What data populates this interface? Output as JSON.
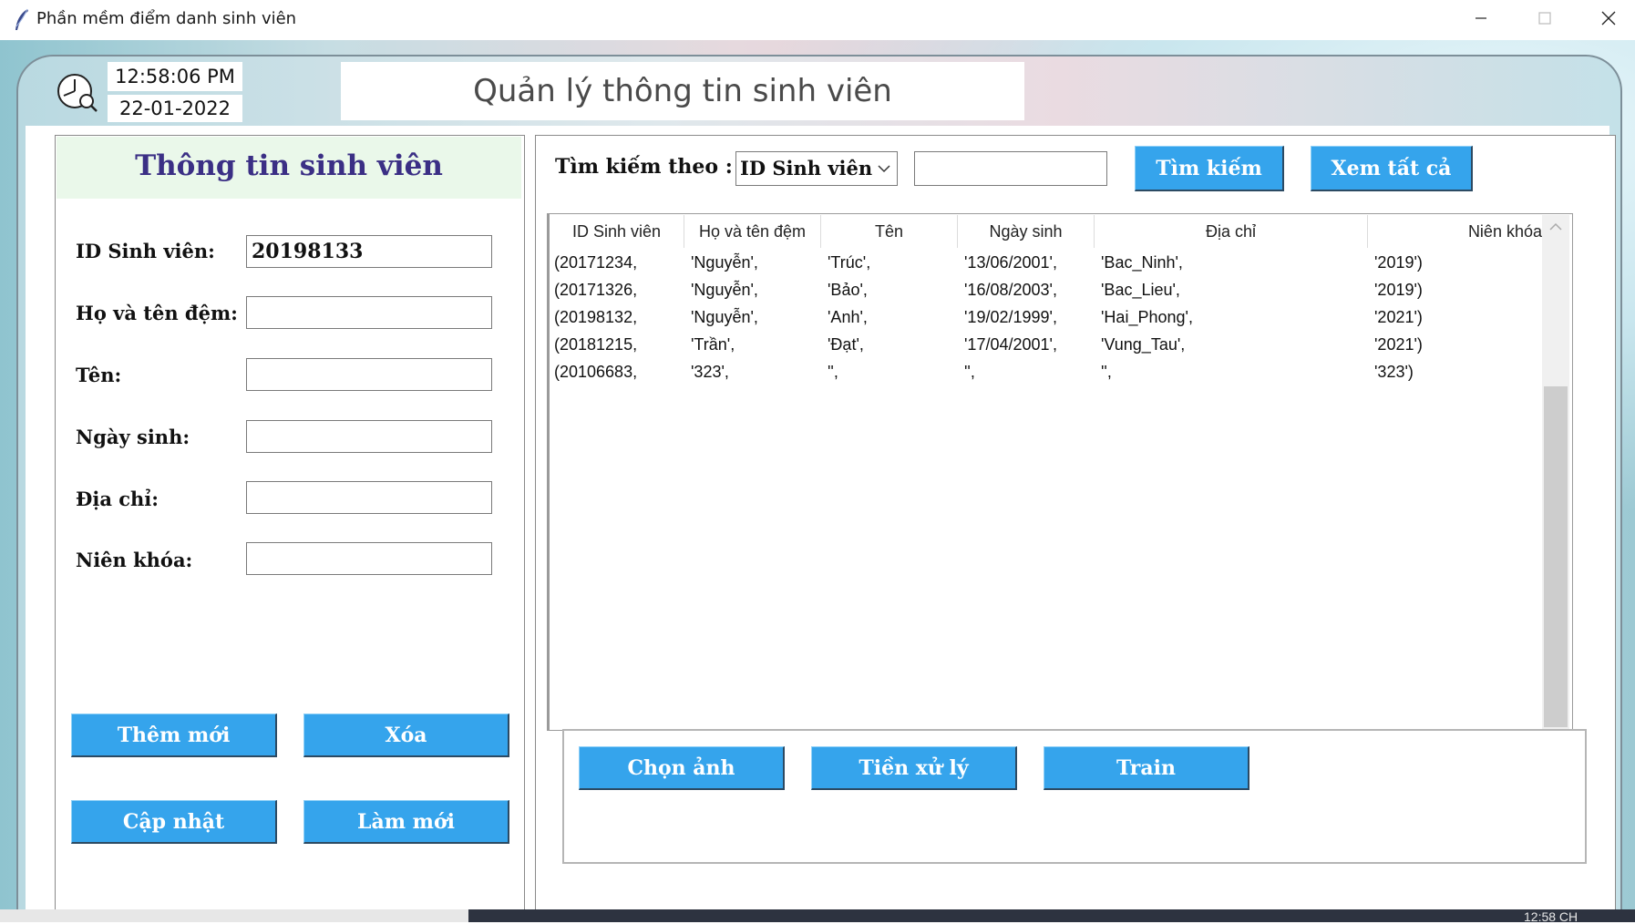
{
  "window": {
    "title": "Phần mềm điểm danh sinh viên",
    "minimize_icon": "minimize-icon",
    "maximize_icon": "maximize-icon",
    "close_icon": "close-icon"
  },
  "header": {
    "time": "12:58:06 PM",
    "date": "22-01-2022",
    "title": "Quản lý thông tin sinh viên",
    "clock_icon": "clock-icon"
  },
  "student_form": {
    "title": "Thông tin sinh viên",
    "fields": [
      {
        "label": "ID Sinh viên:",
        "value": "20198133"
      },
      {
        "label": "Họ và tên đệm:",
        "value": ""
      },
      {
        "label": "Tên:",
        "value": ""
      },
      {
        "label": "Ngày sinh:",
        "value": ""
      },
      {
        "label": "Địa chỉ:",
        "value": ""
      },
      {
        "label": "Niên khóa:",
        "value": ""
      }
    ],
    "buttons": {
      "add": "Thêm mới",
      "delete": "Xóa",
      "update": "Cập nhật",
      "refresh": "Làm mới"
    }
  },
  "search": {
    "label": "Tìm kiếm theo :",
    "selected": "ID Sinh viên",
    "query": "",
    "search_button": "Tìm kiếm",
    "view_all_button": "Xem tất cả"
  },
  "table": {
    "columns": [
      "ID Sinh viên",
      "Họ và tên đệm",
      "Tên",
      "Ngày sinh",
      "Địa chỉ",
      "Niên khóa"
    ],
    "rows": [
      [
        "(20171234,",
        "'Nguyễn',",
        "'Trúc',",
        "'13/06/2001',",
        "'Bac_Ninh',",
        "'2019')"
      ],
      [
        "(20171326,",
        "'Nguyễn',",
        "'Bảo',",
        "'16/08/2003',",
        "'Bac_Lieu',",
        "'2019')"
      ],
      [
        "(20198132,",
        "'Nguyễn',",
        "'Anh',",
        "'19/02/1999',",
        "'Hai_Phong',",
        "'2021')"
      ],
      [
        "(20181215,",
        "'Trần',",
        "'Đạt',",
        "'17/04/2001',",
        "'Vung_Tau',",
        "'2021')"
      ],
      [
        "(20106683,",
        "'323',",
        "'',",
        "'',",
        "'',",
        "'323')"
      ]
    ]
  },
  "image_actions": {
    "choose_image": "Chọn ảnh",
    "preprocess": "Tiền xử lý",
    "train": "Train"
  },
  "taskbar": {
    "clock": "12:58 CH"
  },
  "colors": {
    "button_bg": "#35a4ec",
    "form_title": "#3b2f85",
    "form_header_bg": "#eaf8ea"
  }
}
